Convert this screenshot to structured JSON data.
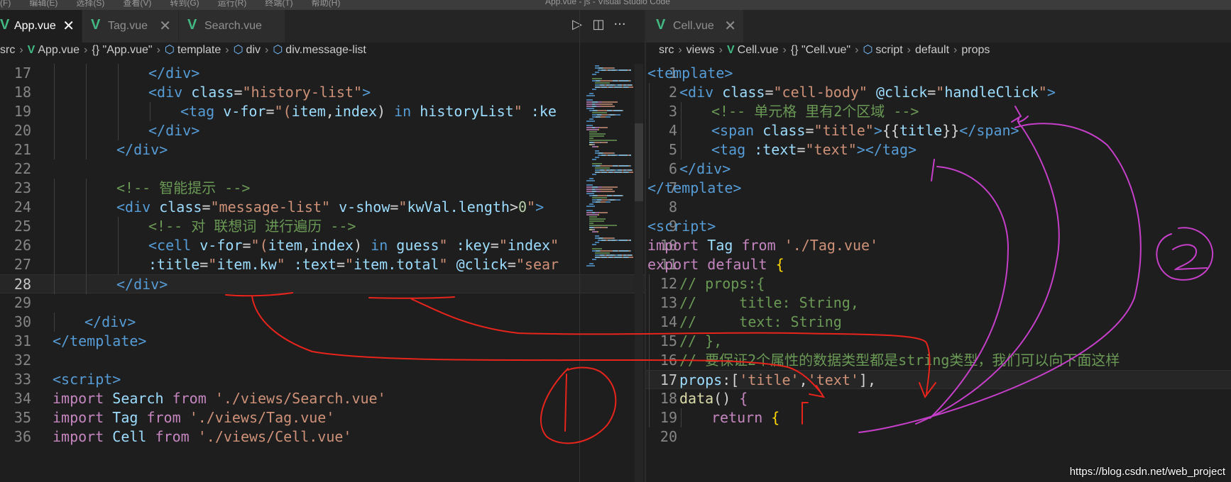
{
  "window": {
    "menu": [
      "(F)",
      "编辑(E)",
      "选择(S)",
      "查看(V)",
      "转到(G)",
      "运行(R)",
      "终端(T)",
      "帮助(H)"
    ],
    "title": "App.vue - js - Visual Studio Code"
  },
  "left": {
    "tabs": [
      {
        "label": "App.vue",
        "close": "✕",
        "active": true
      },
      {
        "label": "Tag.vue",
        "close": "✕",
        "active": false
      },
      {
        "label": "Search.vue",
        "close": "",
        "active": false
      }
    ],
    "actions": {
      "run": "▷",
      "split": "◫",
      "more": "···"
    },
    "breadcrumb": [
      "src",
      "App.vue",
      "{} \"App.vue\"",
      "template",
      "div",
      "div.message-list"
    ],
    "lines": [
      {
        "n": "17",
        "i": 3,
        "t": [
          [
            "</",
            "tg"
          ],
          [
            "div",
            "tg"
          ],
          [
            ">",
            "tg"
          ]
        ]
      },
      {
        "n": "18",
        "i": 3,
        "t": [
          [
            "<",
            "tg"
          ],
          [
            "div ",
            "tg"
          ],
          [
            "class",
            "an"
          ],
          [
            "=",
            "tx"
          ],
          [
            "\"history-list\"",
            "st"
          ],
          [
            ">",
            "tg"
          ]
        ]
      },
      {
        "n": "19",
        "i": 4,
        "t": [
          [
            "<",
            "tg"
          ],
          [
            "tag ",
            "tg"
          ],
          [
            "v-for",
            "an"
          ],
          [
            "=",
            "tx"
          ],
          [
            "\"(",
            "st"
          ],
          [
            "item",
            "an"
          ],
          [
            ",",
            "tx"
          ],
          [
            "index",
            "an"
          ],
          [
            ") ",
            "tx"
          ],
          [
            "in ",
            "tg"
          ],
          [
            "historyList",
            "an"
          ],
          [
            "\" ",
            "st"
          ],
          [
            ":ke",
            "an"
          ]
        ]
      },
      {
        "n": "20",
        "i": 3,
        "t": [
          [
            "</",
            "tg"
          ],
          [
            "div",
            "tg"
          ],
          [
            ">",
            "tg"
          ]
        ]
      },
      {
        "n": "21",
        "i": 2,
        "t": [
          [
            "</",
            "tg"
          ],
          [
            "div",
            "tg"
          ],
          [
            ">",
            "tg"
          ]
        ]
      },
      {
        "n": "22",
        "i": 0,
        "t": []
      },
      {
        "n": "23",
        "i": 2,
        "t": [
          [
            "<!-- 智能提示 -->",
            "cm"
          ]
        ]
      },
      {
        "n": "24",
        "i": 2,
        "t": [
          [
            "<",
            "tg"
          ],
          [
            "div ",
            "tg"
          ],
          [
            "class",
            "an"
          ],
          [
            "=",
            "tx"
          ],
          [
            "\"message-list\" ",
            "st"
          ],
          [
            "v-show",
            "an"
          ],
          [
            "=",
            "tx"
          ],
          [
            "\"",
            "st"
          ],
          [
            "kwVal.length",
            "an"
          ],
          [
            ">",
            "tx"
          ],
          [
            "0",
            "nu"
          ],
          [
            "\"",
            "st"
          ],
          [
            ">",
            "tg"
          ]
        ]
      },
      {
        "n": "25",
        "i": 3,
        "t": [
          [
            "<!-- 对 联想词 进行遍历 -->",
            "cm"
          ]
        ]
      },
      {
        "n": "26",
        "i": 3,
        "t": [
          [
            "<",
            "tg"
          ],
          [
            "cell ",
            "tg"
          ],
          [
            "v-for",
            "an"
          ],
          [
            "=",
            "tx"
          ],
          [
            "\"(",
            "st"
          ],
          [
            "item",
            "an"
          ],
          [
            ",",
            "tx"
          ],
          [
            "index",
            "an"
          ],
          [
            ") ",
            "tx"
          ],
          [
            "in ",
            "tg"
          ],
          [
            "guess",
            "an"
          ],
          [
            "\" ",
            "st"
          ],
          [
            ":key",
            "an"
          ],
          [
            "=",
            "tx"
          ],
          [
            "\"",
            "st"
          ],
          [
            "index",
            "an"
          ],
          [
            "\"",
            "st"
          ]
        ]
      },
      {
        "n": "27",
        "i": 3,
        "t": [
          [
            ":title",
            "an"
          ],
          [
            "=",
            "tx"
          ],
          [
            "\"",
            "st"
          ],
          [
            "item.kw",
            "an"
          ],
          [
            "\" ",
            "st"
          ],
          [
            ":text",
            "an"
          ],
          [
            "=",
            "tx"
          ],
          [
            "\"",
            "st"
          ],
          [
            "item.total",
            "an"
          ],
          [
            "\" ",
            "st"
          ],
          [
            "@click",
            "an"
          ],
          [
            "=",
            "tx"
          ],
          [
            "\"sear",
            "st"
          ]
        ]
      },
      {
        "n": "28",
        "i": 2,
        "cur": true,
        "t": [
          [
            "</",
            "tg"
          ],
          [
            "div",
            "tg"
          ],
          [
            ">",
            "tg"
          ]
        ]
      },
      {
        "n": "29",
        "i": 0,
        "t": []
      },
      {
        "n": "30",
        "i": 1,
        "t": [
          [
            "</",
            "tg"
          ],
          [
            "div",
            "tg"
          ],
          [
            ">",
            "tg"
          ]
        ]
      },
      {
        "n": "31",
        "i": 0,
        "t": [
          [
            "</",
            "tg"
          ],
          [
            "template",
            "tg"
          ],
          [
            ">",
            "tg"
          ]
        ]
      },
      {
        "n": "32",
        "i": 0,
        "t": []
      },
      {
        "n": "33",
        "i": 0,
        "t": [
          [
            "<",
            "tg"
          ],
          [
            "script",
            "tg"
          ],
          [
            ">",
            "tg"
          ]
        ]
      },
      {
        "n": "34",
        "i": 0,
        "t": [
          [
            "import ",
            "kw"
          ],
          [
            "Search ",
            "an"
          ],
          [
            "from ",
            "kw"
          ],
          [
            "'./views/Search.vue'",
            "st"
          ]
        ]
      },
      {
        "n": "35",
        "i": 0,
        "t": [
          [
            "import ",
            "kw"
          ],
          [
            "Tag ",
            "an"
          ],
          [
            "from ",
            "kw"
          ],
          [
            "'./views/Tag.vue'",
            "st"
          ]
        ]
      },
      {
        "n": "36",
        "i": 0,
        "t": [
          [
            "import ",
            "kw"
          ],
          [
            "Cell ",
            "an"
          ],
          [
            "from ",
            "kw"
          ],
          [
            "'./views/Cell.vue'",
            "st"
          ]
        ]
      }
    ]
  },
  "right": {
    "tabs": [
      {
        "label": "Cell.vue",
        "close": "✕",
        "active": false
      }
    ],
    "breadcrumb": [
      "src",
      "views",
      "Cell.vue",
      "{} \"Cell.vue\"",
      "script",
      "default",
      "props"
    ],
    "lines": [
      {
        "n": "1",
        "i": 0,
        "t": [
          [
            "<",
            "tg"
          ],
          [
            "template",
            "tg"
          ],
          [
            ">",
            "tg"
          ]
        ]
      },
      {
        "n": "2",
        "i": 1,
        "t": [
          [
            "<",
            "tg"
          ],
          [
            "div ",
            "tg"
          ],
          [
            "class",
            "an"
          ],
          [
            "=",
            "tx"
          ],
          [
            "\"cell-body\" ",
            "st"
          ],
          [
            "@click",
            "an"
          ],
          [
            "=",
            "tx"
          ],
          [
            "\"",
            "st"
          ],
          [
            "handleClick",
            "an"
          ],
          [
            "\"",
            "st"
          ],
          [
            ">",
            "tg"
          ]
        ]
      },
      {
        "n": "3",
        "i": 2,
        "t": [
          [
            "<!-- 单元格 里有2个区域 -->",
            "cm"
          ]
        ]
      },
      {
        "n": "4",
        "i": 2,
        "t": [
          [
            "<",
            "tg"
          ],
          [
            "span ",
            "tg"
          ],
          [
            "class",
            "an"
          ],
          [
            "=",
            "tx"
          ],
          [
            "\"title\"",
            "st"
          ],
          [
            ">",
            "tg"
          ],
          [
            "{{",
            "tx"
          ],
          [
            "title",
            "an"
          ],
          [
            "}}",
            "tx"
          ],
          [
            "</",
            "tg"
          ],
          [
            "span",
            "tg"
          ],
          [
            ">",
            "tg"
          ]
        ]
      },
      {
        "n": "5",
        "i": 2,
        "t": [
          [
            "<",
            "tg"
          ],
          [
            "tag ",
            "tg"
          ],
          [
            ":text",
            "an"
          ],
          [
            "=",
            "tx"
          ],
          [
            "\"text\"",
            "st"
          ],
          [
            "></",
            "tg"
          ],
          [
            "tag",
            "tg"
          ],
          [
            ">",
            "tg"
          ]
        ]
      },
      {
        "n": "6",
        "i": 1,
        "t": [
          [
            "</",
            "tg"
          ],
          [
            "div",
            "tg"
          ],
          [
            ">",
            "tg"
          ]
        ]
      },
      {
        "n": "7",
        "i": 0,
        "t": [
          [
            "</",
            "tg"
          ],
          [
            "template",
            "tg"
          ],
          [
            ">",
            "tg"
          ]
        ]
      },
      {
        "n": "8",
        "i": 0,
        "t": []
      },
      {
        "n": "9",
        "i": 0,
        "t": [
          [
            "<",
            "tg"
          ],
          [
            "script",
            "tg"
          ],
          [
            ">",
            "tg"
          ]
        ]
      },
      {
        "n": "10",
        "i": 0,
        "t": [
          [
            "import ",
            "kw"
          ],
          [
            "Tag ",
            "an"
          ],
          [
            "from ",
            "kw"
          ],
          [
            "'./Tag.vue'",
            "st"
          ]
        ]
      },
      {
        "n": "11",
        "i": 0,
        "t": [
          [
            "export ",
            "kw"
          ],
          [
            "default ",
            "kw"
          ],
          [
            "{",
            "br"
          ]
        ]
      },
      {
        "n": "12",
        "i": 1,
        "t": [
          [
            "// props:{",
            "cm"
          ]
        ]
      },
      {
        "n": "13",
        "i": 1,
        "t": [
          [
            "//     title: String,",
            "cm"
          ]
        ]
      },
      {
        "n": "14",
        "i": 1,
        "t": [
          [
            "//     text: String",
            "cm"
          ]
        ]
      },
      {
        "n": "15",
        "i": 1,
        "t": [
          [
            "// },",
            "cm"
          ]
        ]
      },
      {
        "n": "16",
        "i": 1,
        "t": [
          [
            "// 要保证2个属性的数据类型都是string类型，我们可以向下面这样",
            "cm"
          ]
        ]
      },
      {
        "n": "17",
        "i": 1,
        "cur": true,
        "t": [
          [
            "props",
            "an"
          ],
          [
            ":",
            "tx"
          ],
          [
            "[",
            "tx"
          ],
          [
            "'title'",
            "st"
          ],
          [
            ",",
            "tx"
          ],
          [
            "'text'",
            "st"
          ],
          [
            "]",
            "tx"
          ],
          [
            ",",
            "tx"
          ]
        ]
      },
      {
        "n": "18",
        "i": 1,
        "t": [
          [
            "data",
            "fn"
          ],
          [
            "() ",
            "tx"
          ],
          [
            "{",
            "kw"
          ]
        ]
      },
      {
        "n": "19",
        "i": 2,
        "t": [
          [
            "return ",
            "kw"
          ],
          [
            "{",
            "br"
          ]
        ]
      },
      {
        "n": "20",
        "i": 0,
        "t": []
      }
    ]
  },
  "watermark": "https://blog.csdn.net/web_project",
  "colors": {
    "background": "#1e1e1e",
    "tag": "#569cd6",
    "attribute": "#9cdcfe",
    "string": "#ce9178",
    "comment": "#6a9955",
    "keyword": "#c586c0",
    "vue_icon": "#42b883",
    "annotation_red": "#e8241c",
    "annotation_magenta": "#c53fc9"
  }
}
